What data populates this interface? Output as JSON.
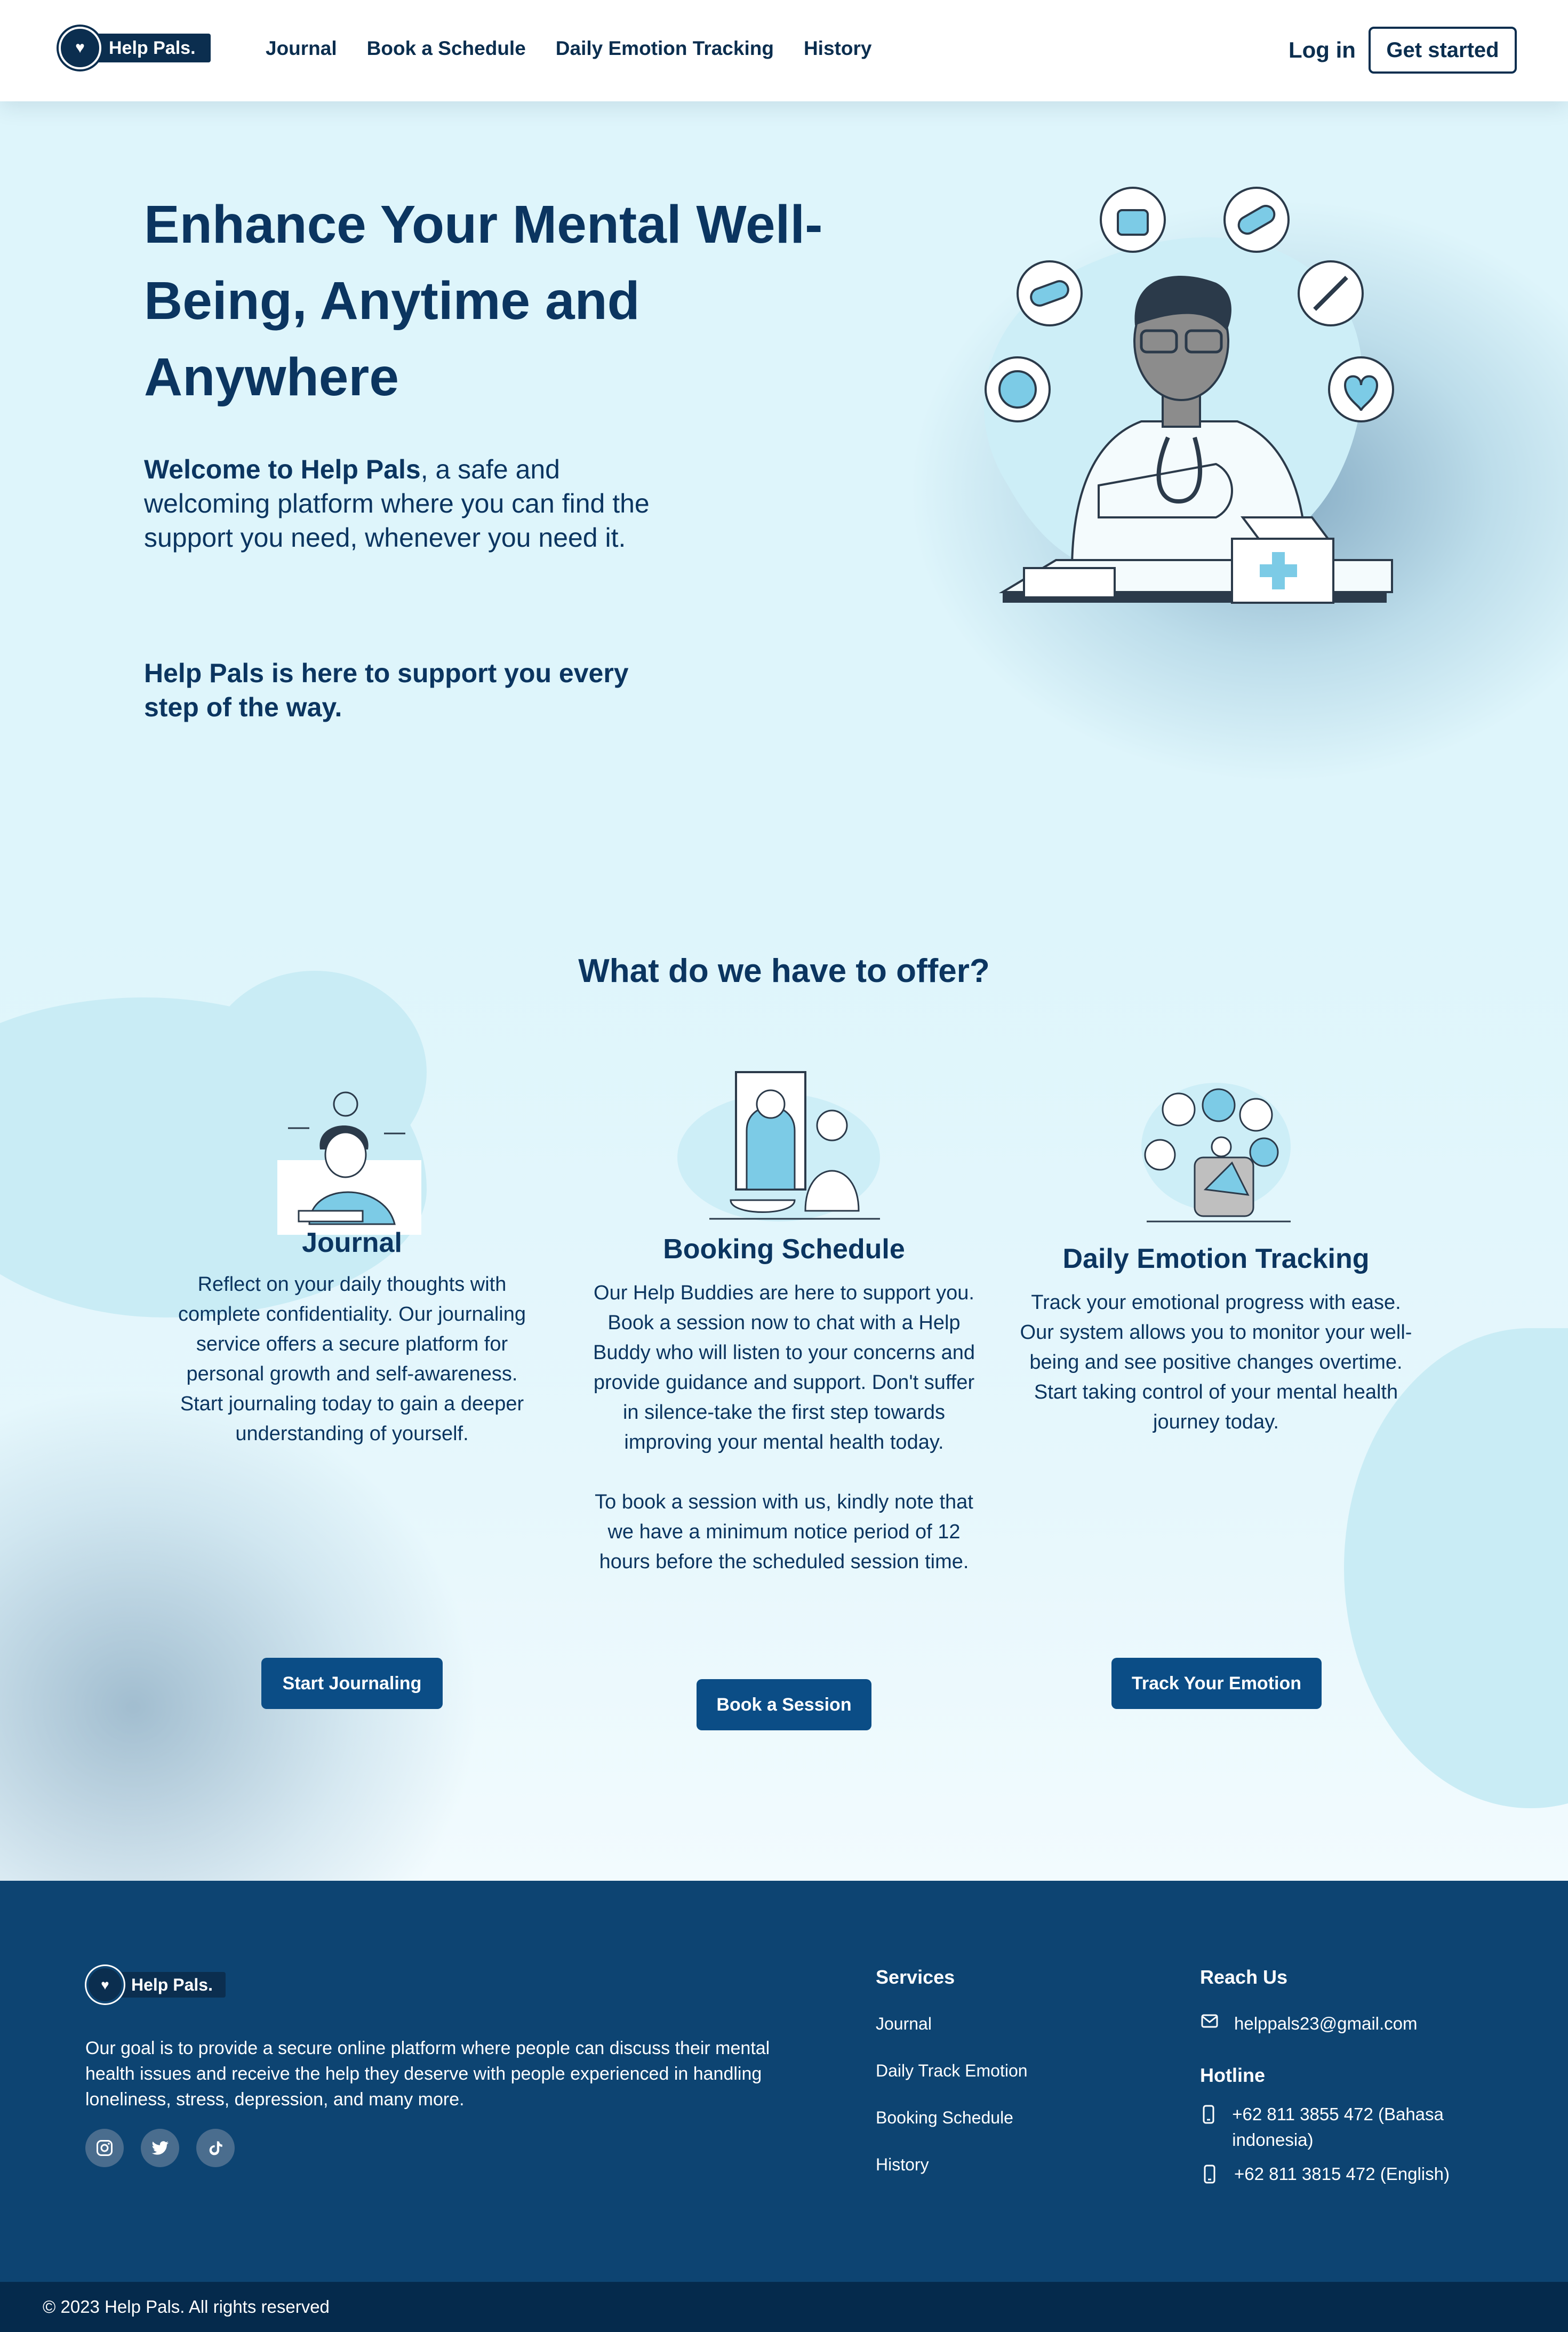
{
  "brand": {
    "name": "Help Pals."
  },
  "nav": {
    "links": [
      "Journal",
      "Book a Schedule",
      "Daily Emotion Tracking",
      "History"
    ],
    "login": "Log in",
    "get_started": "Get started"
  },
  "hero": {
    "title": "Enhance Your Mental Well-Being, Anytime and Anywhere",
    "welcome_bold": "Welcome to Help Pals",
    "welcome_rest": ", a safe and welcoming platform where you can find the support you need, whenever you need it.",
    "support": "Help Pals is here to support you every step of the way."
  },
  "offer": {
    "title": "What do we have to offer?",
    "cards": [
      {
        "title": "Journal",
        "text": "Reflect on your daily thoughts with complete confidentiality. Our journaling service offers a secure platform for personal growth and self-awareness. Start journaling today to gain a deeper understanding of yourself.",
        "button": "Start Journaling"
      },
      {
        "title": "Booking Schedule",
        "text": "Our Help Buddies are here to support you. Book a session now to chat with a Help Buddy who will listen to your concerns and provide guidance and support. Don't suffer in silence-take the first step towards improving your mental health today.",
        "text2": "To book a session with us, kindly note that we have a minimum notice period of 12 hours before the scheduled session time.",
        "button": "Book a Session"
      },
      {
        "title": "Daily Emotion Tracking",
        "text": "Track your emotional progress with ease. Our system allows you to monitor your well-being and see positive changes overtime. Start taking control of your mental health journey today.",
        "button": "Track Your Emotion"
      }
    ]
  },
  "footer": {
    "description": "Our goal is to provide a secure online platform where people can discuss their mental health issues and receive the help they deserve with people experienced in handling loneliness, stress, depression, and many more.",
    "socials": [
      "instagram-icon",
      "twitter-icon",
      "tiktok-icon"
    ],
    "services_title": "Services",
    "services": [
      "Journal",
      "Daily Track Emotion",
      "Booking Schedule",
      "History"
    ],
    "reach_title": "Reach Us",
    "email": "helppals23@gmail.com",
    "hotline_title": "Hotline",
    "phones": [
      "+62 811 3855 472 (Bahasa indonesia)",
      "+62 811 3815 472 (English)"
    ],
    "copyright": "© 2023 Help Pals. All rights reserved"
  },
  "colors": {
    "navy": "#0b3560",
    "button": "#0b4d86",
    "footer": "#0d4472",
    "copyright_bar": "#052a4c",
    "accent_light": "#7ccbe6"
  }
}
